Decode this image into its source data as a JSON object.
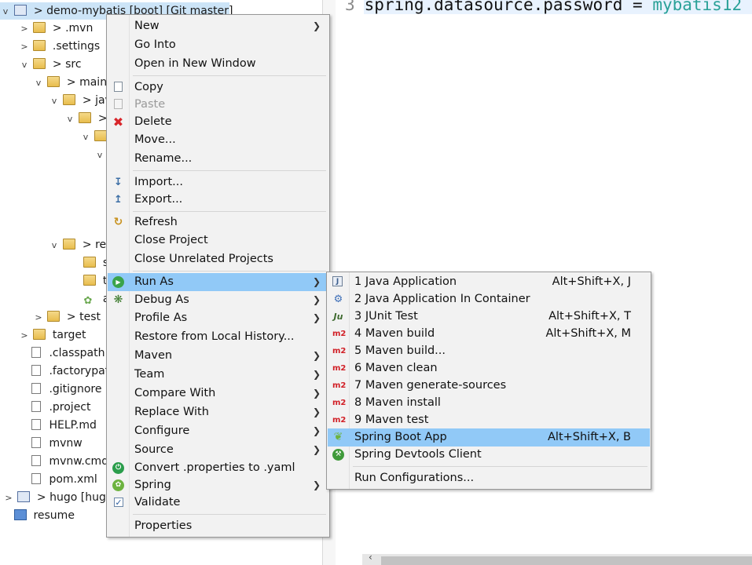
{
  "tree": {
    "project_label": "> demo-mybatis [boot] [Git master]",
    "nodes": [
      {
        "label": "> .mvn"
      },
      {
        "label": ".settings"
      },
      {
        "label": "> src"
      },
      {
        "label": "> main"
      },
      {
        "label": "> jav"
      },
      {
        "label": ">"
      },
      {
        "label": ""
      },
      {
        "label": "> re"
      },
      {
        "label": "st"
      },
      {
        "label": "te"
      },
      {
        "label": "ap"
      },
      {
        "label": "> test"
      },
      {
        "label": "target"
      },
      {
        "label": ".classpath"
      },
      {
        "label": ".factorypat"
      },
      {
        "label": ".gitignore"
      },
      {
        "label": ".project"
      },
      {
        "label": "HELP.md"
      },
      {
        "label": "mvnw"
      },
      {
        "label": "mvnw.cmd"
      },
      {
        "label": "pom.xml"
      },
      {
        "label": "> hugo [hug"
      },
      {
        "label": "resume"
      }
    ]
  },
  "editor": {
    "line_number": "3",
    "code_key": "spring.datasource.password = ",
    "code_value": "mybatis12"
  },
  "context_menu": {
    "items": [
      {
        "label": "New",
        "submenu": true
      },
      {
        "label": "Go Into"
      },
      {
        "label": "Open in New Window"
      },
      {
        "label": "Copy",
        "icon": "copy-icon"
      },
      {
        "label": "Paste",
        "icon": "paste-icon",
        "disabled": true
      },
      {
        "label": "Delete",
        "icon": "delete-icon"
      },
      {
        "label": "Move..."
      },
      {
        "label": "Rename..."
      },
      {
        "label": "Import...",
        "icon": "import-icon"
      },
      {
        "label": "Export...",
        "icon": "export-icon"
      },
      {
        "label": "Refresh",
        "icon": "refresh-icon"
      },
      {
        "label": "Close Project"
      },
      {
        "label": "Close Unrelated Projects"
      },
      {
        "label": "Run As",
        "icon": "run-icon",
        "submenu": true,
        "highlighted": true
      },
      {
        "label": "Debug As",
        "icon": "debug-icon",
        "submenu": true
      },
      {
        "label": "Profile As",
        "submenu": true
      },
      {
        "label": "Restore from Local History..."
      },
      {
        "label": "Maven",
        "submenu": true
      },
      {
        "label": "Team",
        "submenu": true
      },
      {
        "label": "Compare With",
        "submenu": true
      },
      {
        "label": "Replace With",
        "submenu": true
      },
      {
        "label": "Configure",
        "submenu": true
      },
      {
        "label": "Source",
        "submenu": true
      },
      {
        "label": "Convert .properties to .yaml",
        "icon": "convert-icon"
      },
      {
        "label": "Spring",
        "icon": "spring-icon",
        "submenu": true
      },
      {
        "label": "Validate",
        "icon": "validate-check-icon"
      },
      {
        "label": "Properties"
      }
    ]
  },
  "run_as_submenu": {
    "items": [
      {
        "label": "1 Java Application",
        "accel": "Alt+Shift+X, J",
        "icon": "java-application-icon"
      },
      {
        "label": "2 Java Application In Container",
        "accel": "",
        "icon": "java-container-icon"
      },
      {
        "label": "3 JUnit Test",
        "accel": "Alt+Shift+X, T",
        "icon": "junit-icon"
      },
      {
        "label": "4 Maven build",
        "accel": "Alt+Shift+X, M",
        "icon": "maven-icon"
      },
      {
        "label": "5 Maven build...",
        "accel": "",
        "icon": "maven-icon"
      },
      {
        "label": "6 Maven clean",
        "accel": "",
        "icon": "maven-icon"
      },
      {
        "label": "7 Maven generate-sources",
        "accel": "",
        "icon": "maven-icon"
      },
      {
        "label": "8 Maven install",
        "accel": "",
        "icon": "maven-icon"
      },
      {
        "label": "9 Maven test",
        "accel": "",
        "icon": "maven-icon"
      },
      {
        "label": "Spring Boot App",
        "accel": "Alt+Shift+X, B",
        "icon": "spring-boot-icon",
        "highlighted": true
      },
      {
        "label": "Spring Devtools Client",
        "accel": "",
        "icon": "devtools-icon"
      },
      {
        "label": "Run Configurations...",
        "accel": ""
      }
    ]
  },
  "icon_glyphs": {
    "maven": "m2",
    "junit": "Ju"
  },
  "colors": {
    "selection": "#cce4f7",
    "menu_highlight": "#91c9f7",
    "menu_bg": "#f2f2f2",
    "code_value": "#2aa198"
  }
}
